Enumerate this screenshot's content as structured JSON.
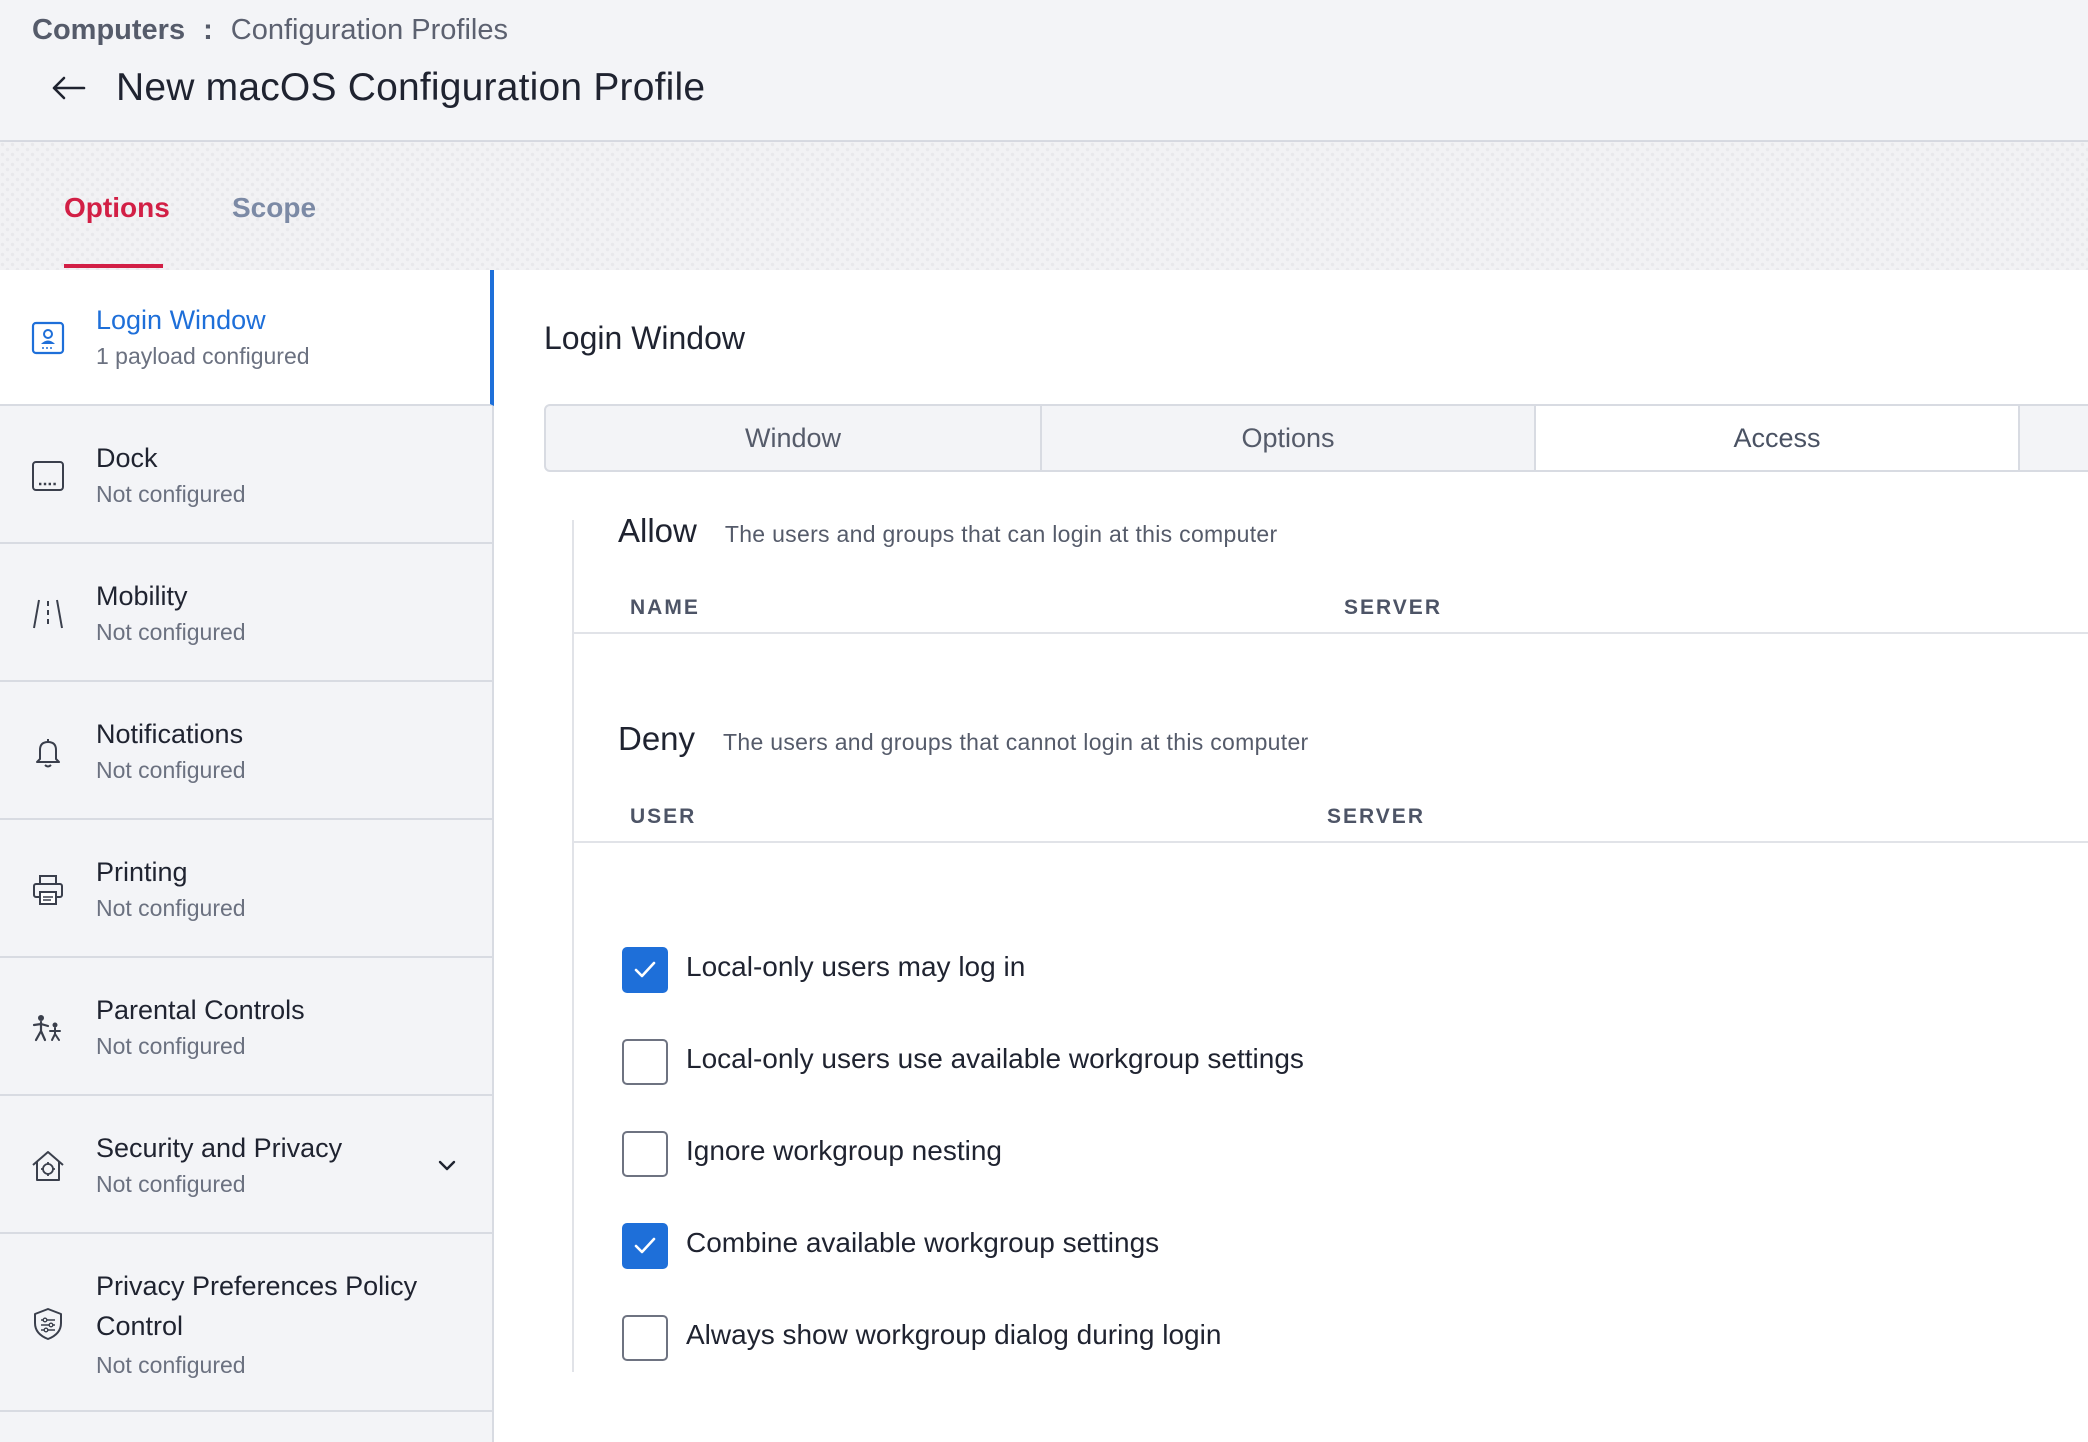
{
  "breadcrumb": {
    "parent": "Computers",
    "separator": ":",
    "current": "Configuration Profiles"
  },
  "page_title": "New macOS Configuration Profile",
  "tabs": [
    {
      "label": "Options",
      "active": true
    },
    {
      "label": "Scope",
      "active": false
    }
  ],
  "sidebar": {
    "items": [
      {
        "title": "Login Window",
        "subtitle": "1 payload configured",
        "icon": "login-window-icon",
        "active": true
      },
      {
        "title": "Dock",
        "subtitle": "Not configured",
        "icon": "dock-icon"
      },
      {
        "title": "Mobility",
        "subtitle": "Not configured",
        "icon": "mobility-icon"
      },
      {
        "title": "Notifications",
        "subtitle": "Not configured",
        "icon": "bell-icon"
      },
      {
        "title": "Printing",
        "subtitle": "Not configured",
        "icon": "printer-icon"
      },
      {
        "title": "Parental Controls",
        "subtitle": "Not configured",
        "icon": "parental-controls-icon"
      },
      {
        "title": "Security and Privacy",
        "subtitle": "Not configured",
        "icon": "security-house-icon",
        "expandable": true
      },
      {
        "title_line1": "Privacy Preferences Policy",
        "title_line2": "Control",
        "subtitle": "Not configured",
        "icon": "privacy-shield-icon"
      }
    ]
  },
  "main": {
    "section_title": "Login Window",
    "segments": [
      {
        "label": "Window",
        "active": false
      },
      {
        "label": "Options",
        "active": false
      },
      {
        "label": "Access",
        "active": true
      }
    ],
    "allow": {
      "label": "Allow",
      "description": "The users and groups that can login at this computer",
      "columns": [
        "NAME",
        "SERVER"
      ]
    },
    "deny": {
      "label": "Deny",
      "description": "The users and groups that cannot login at this computer",
      "columns": [
        "USER",
        "SERVER"
      ]
    },
    "checkboxes": [
      {
        "label": "Local-only users may log in",
        "checked": true
      },
      {
        "label": "Local-only users use available workgroup settings",
        "checked": false
      },
      {
        "label": "Ignore workgroup nesting",
        "checked": false
      },
      {
        "label": "Combine available workgroup settings",
        "checked": true
      },
      {
        "label": "Always show workgroup dialog during login",
        "checked": false
      }
    ]
  },
  "colors": {
    "accent_red": "#d21f45",
    "accent_blue": "#1e6fd9",
    "background": "#f3f4f7"
  }
}
